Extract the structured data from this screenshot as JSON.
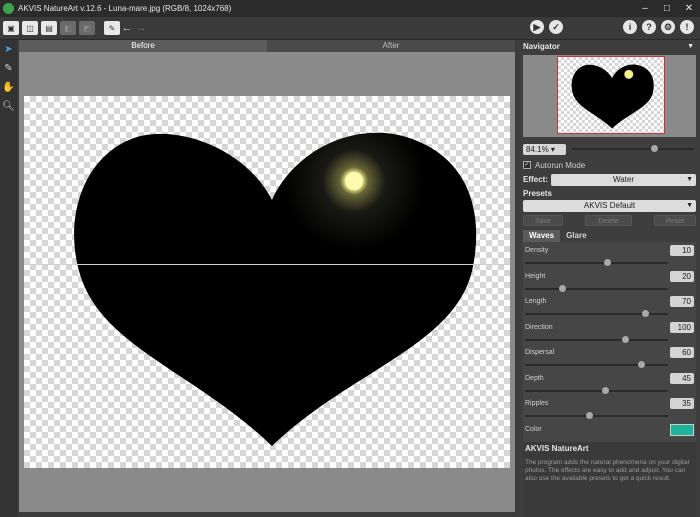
{
  "window": {
    "title": "AKVIS NatureArt v.12.6 - Luna-mare.jpg (RGB/8, 1024x768)",
    "minimize": "–",
    "maximize": "□",
    "close": "✕"
  },
  "toolbar": {
    "back": "←",
    "forward": "→",
    "right_buttons": [
      "▶",
      "✓",
      "i",
      "?",
      "⚙",
      "!"
    ]
  },
  "view_tabs": {
    "before": "Before",
    "after": "After"
  },
  "navigator": {
    "title": "Navigator",
    "zoom": "84.1%",
    "zoom_slider": 0.65
  },
  "autorun": {
    "label": "Autorun Mode",
    "checked": true
  },
  "effect": {
    "label": "Effect:",
    "value": "Water"
  },
  "presets": {
    "label": "Presets",
    "value": "AKVIS Default",
    "save": "Save",
    "delete": "Delete",
    "reset": "Reset"
  },
  "tabs": {
    "waves": "Waves",
    "glare": "Glare"
  },
  "params": [
    {
      "name": "Density",
      "value": "10",
      "pos": 0.55
    },
    {
      "name": "Height",
      "value": "20",
      "pos": 0.24
    },
    {
      "name": "Length",
      "value": "70",
      "pos": 0.82
    },
    {
      "name": "Direction",
      "value": "100",
      "pos": 0.68
    },
    {
      "name": "Dispersal",
      "value": "60",
      "pos": 0.79
    },
    {
      "name": "Depth",
      "value": "45",
      "pos": 0.54
    },
    {
      "name": "Ripples",
      "value": "35",
      "pos": 0.43
    }
  ],
  "color": {
    "label": "Color",
    "value": "#1fb39a"
  },
  "info": {
    "title": "AKVIS NatureArt",
    "text": "The program adds the natural phenomena on your digital photos. The effects are easy to add and adjust. You can also use the available presets to get a quick result."
  },
  "colors": {
    "accent": "#4aa3df",
    "moon": "#f6f08a"
  }
}
